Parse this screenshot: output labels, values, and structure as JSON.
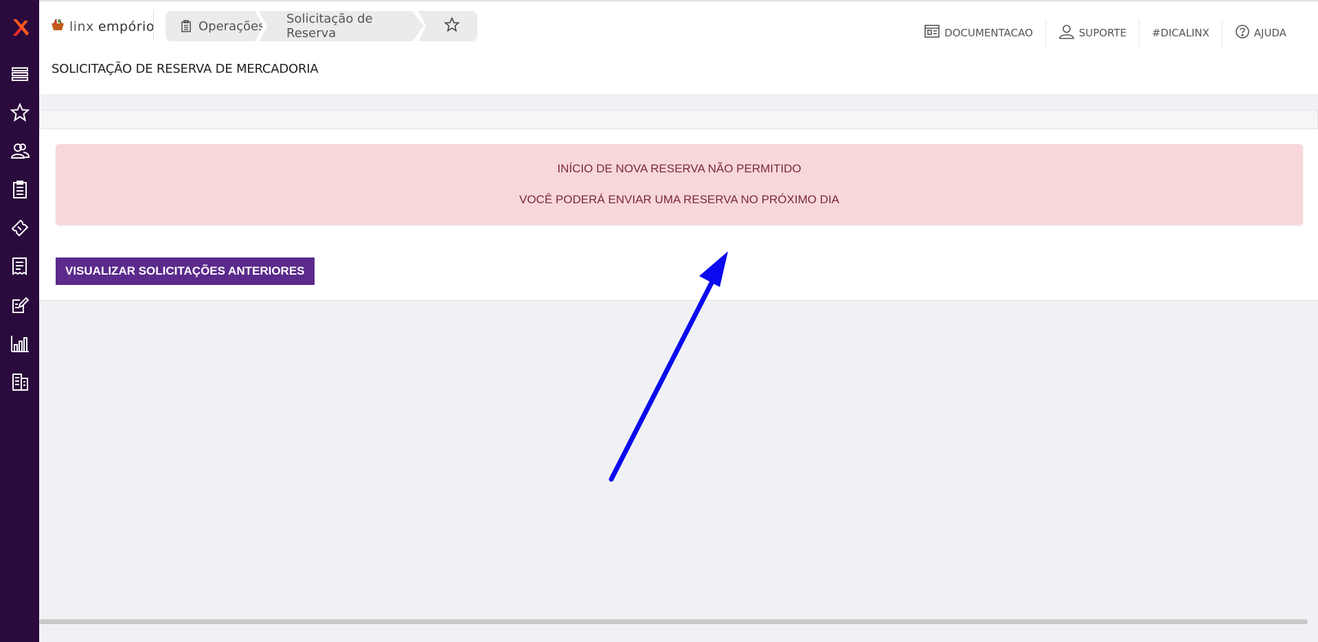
{
  "app": {
    "brand_part1": "linx",
    "brand_part2": "empório"
  },
  "sidebar": {
    "items": [
      {
        "icon": "menu-icon"
      },
      {
        "icon": "star-icon"
      },
      {
        "icon": "users-icon"
      },
      {
        "icon": "clipboard-icon"
      },
      {
        "icon": "ticket-icon"
      },
      {
        "icon": "receipt-icon"
      },
      {
        "icon": "edit-document-icon"
      },
      {
        "icon": "bar-chart-icon"
      },
      {
        "icon": "building-icon"
      }
    ]
  },
  "breadcrumb": {
    "items": [
      "Operações",
      "Solicitação de Reserva"
    ]
  },
  "topnav": {
    "documentacao": "DOCUMENTACAO",
    "suporte": "SUPORTE",
    "dicalinx": "#DICALINX",
    "ajuda": "AJUDA"
  },
  "page": {
    "title": "SOLICITAÇÃO DE RESERVA DE MERCADORIA"
  },
  "alert": {
    "line1": "INÍCIO DE NOVA RESERVA NÃO PERMITIDO",
    "line2": "VOCÊ PODERÁ ENVIAR UMA RESERVA NO PRÓXIMO DIA"
  },
  "actions": {
    "view_previous": "VISUALIZAR SOLICITAÇÕES ANTERIORES"
  },
  "colors": {
    "sidebar_bg": "#2b0a3d",
    "primary_button": "#5b2a8c",
    "alert_bg": "#f8d7da",
    "alert_text": "#7a2a33",
    "annotation_arrow": "#0a0aee"
  }
}
